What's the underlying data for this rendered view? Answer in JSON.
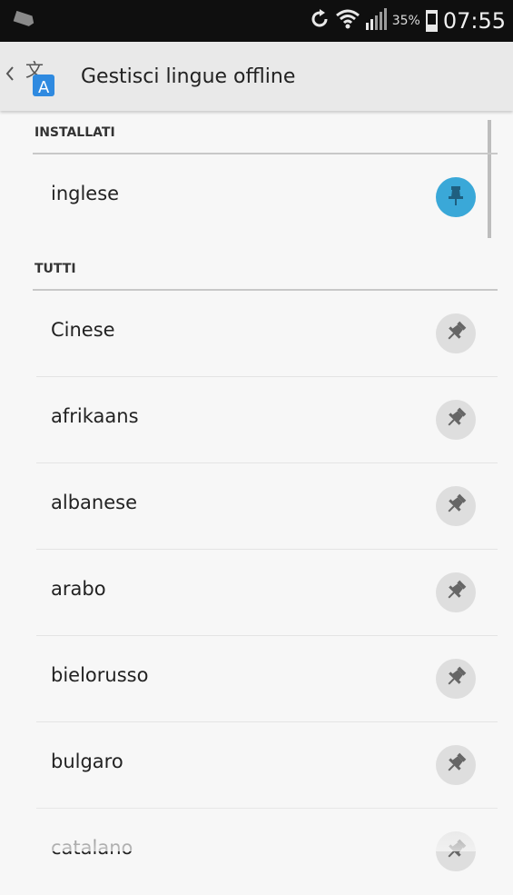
{
  "status_bar": {
    "battery_percent": "35%",
    "time": "07:55",
    "battery_level": 0.35,
    "icons": [
      "message-icon",
      "sync-icon",
      "wifi-icon",
      "signal-icon",
      "battery-icon"
    ]
  },
  "action_bar": {
    "title": "Gestisci lingue offline"
  },
  "sections": {
    "installed": {
      "header": "INSTALLATI",
      "items": [
        {
          "label": "inglese",
          "pinned": true
        }
      ]
    },
    "all": {
      "header": "TUTTI",
      "items": [
        {
          "label": "Cinese",
          "pinned": false
        },
        {
          "label": "afrikaans",
          "pinned": false
        },
        {
          "label": "albanese",
          "pinned": false
        },
        {
          "label": "arabo",
          "pinned": false
        },
        {
          "label": "bielorusso",
          "pinned": false
        },
        {
          "label": "bulgaro",
          "pinned": false
        },
        {
          "label": "catalano",
          "pinned": false
        }
      ]
    }
  },
  "colors": {
    "pinned_accent": "#3aa8d8",
    "unpinned_bg": "#dedede",
    "pin_icon": "#666666"
  }
}
